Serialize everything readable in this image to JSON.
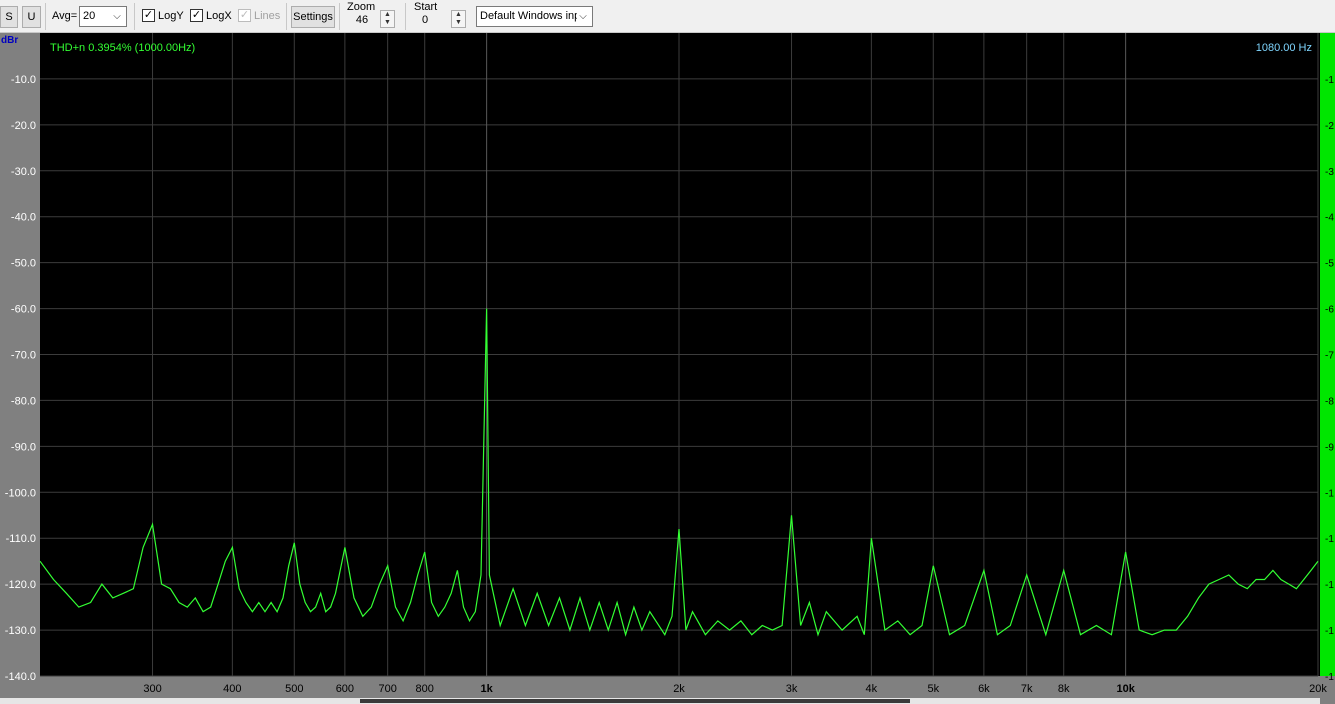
{
  "toolbar": {
    "s_label": "S",
    "u_label": "U",
    "avg_label": "Avg=",
    "avg_value": "20",
    "logy_label": "LogY",
    "logy_checked": true,
    "logx_label": "LogX",
    "logx_checked": true,
    "lines_label": "Lines",
    "lines_checked": true,
    "settings_label": "Settings",
    "zoom_label": "Zoom",
    "zoom_value": "46",
    "start_label": "Start",
    "start_value": "0",
    "input_device": "Default Windows inp",
    "check_mark": "✓",
    "chevron": "⌵",
    "spin_up": "▲",
    "spin_down": "▼"
  },
  "readouts": {
    "thd": "THD+n 0.3954% (1000.00Hz)",
    "cursor_freq": "1080.00 Hz",
    "y_unit": "dBr"
  },
  "colors": {
    "plot_bg": "#000000",
    "trace": "#33ff33",
    "grid": "#3c3c3c",
    "axis_bg": "#808080",
    "cursor_text": "#7fd6ff",
    "right_strip": "#00e600"
  },
  "chart_data": {
    "type": "line",
    "x_scale": "log",
    "xlim": [
      200,
      20000
    ],
    "ylim": [
      -140,
      0
    ],
    "grid": true,
    "y_ticks": [
      "-10.0",
      "-20.0",
      "-30.0",
      "-40.0",
      "-50.0",
      "-60.0",
      "-70.0",
      "-80.0",
      "-90.0",
      "-100.0",
      "-110.0",
      "-120.0",
      "-130.0",
      "-140.0"
    ],
    "y_tick_values": [
      -10,
      -20,
      -30,
      -40,
      -50,
      -60,
      -70,
      -80,
      -90,
      -100,
      -110,
      -120,
      -130,
      -140
    ],
    "right_ticks": [
      "-1",
      "-2",
      "-3",
      "-4",
      "-5",
      "-6",
      "-7",
      "-8",
      "-9",
      "-1",
      "-1",
      "-1",
      "-1",
      "-1"
    ],
    "x_ticks": [
      {
        "v": 300,
        "label": "300",
        "bold": false
      },
      {
        "v": 400,
        "label": "400",
        "bold": false
      },
      {
        "v": 500,
        "label": "500",
        "bold": false
      },
      {
        "v": 600,
        "label": "600",
        "bold": false
      },
      {
        "v": 700,
        "label": "700",
        "bold": false
      },
      {
        "v": 800,
        "label": "800",
        "bold": false
      },
      {
        "v": 1000,
        "label": "1k",
        "bold": true
      },
      {
        "v": 2000,
        "label": "2k",
        "bold": false
      },
      {
        "v": 3000,
        "label": "3k",
        "bold": false
      },
      {
        "v": 4000,
        "label": "4k",
        "bold": false
      },
      {
        "v": 5000,
        "label": "5k",
        "bold": false
      },
      {
        "v": 6000,
        "label": "6k",
        "bold": false
      },
      {
        "v": 7000,
        "label": "7k",
        "bold": false
      },
      {
        "v": 8000,
        "label": "8k",
        "bold": false
      },
      {
        "v": 10000,
        "label": "10k",
        "bold": true
      },
      {
        "v": 20000,
        "label": "20k",
        "bold": false
      }
    ],
    "series": [
      {
        "points": [
          [
            200,
            -115
          ],
          [
            210,
            -119
          ],
          [
            220,
            -122
          ],
          [
            230,
            -125
          ],
          [
            240,
            -124
          ],
          [
            250,
            -120
          ],
          [
            260,
            -123
          ],
          [
            270,
            -122
          ],
          [
            280,
            -121
          ],
          [
            290,
            -112
          ],
          [
            300,
            -107
          ],
          [
            310,
            -120
          ],
          [
            320,
            -121
          ],
          [
            330,
            -124
          ],
          [
            340,
            -125
          ],
          [
            350,
            -123
          ],
          [
            360,
            -126
          ],
          [
            370,
            -125
          ],
          [
            380,
            -120
          ],
          [
            390,
            -115
          ],
          [
            400,
            -112
          ],
          [
            410,
            -121
          ],
          [
            420,
            -124
          ],
          [
            430,
            -126
          ],
          [
            440,
            -124
          ],
          [
            450,
            -126
          ],
          [
            460,
            -124
          ],
          [
            470,
            -126
          ],
          [
            480,
            -123
          ],
          [
            490,
            -116
          ],
          [
            500,
            -111
          ],
          [
            510,
            -120
          ],
          [
            520,
            -124
          ],
          [
            530,
            -126
          ],
          [
            540,
            -125
          ],
          [
            550,
            -122
          ],
          [
            560,
            -126
          ],
          [
            570,
            -125
          ],
          [
            580,
            -122
          ],
          [
            590,
            -117
          ],
          [
            600,
            -112
          ],
          [
            620,
            -123
          ],
          [
            640,
            -127
          ],
          [
            660,
            -125
          ],
          [
            680,
            -120
          ],
          [
            700,
            -116
          ],
          [
            720,
            -125
          ],
          [
            740,
            -128
          ],
          [
            760,
            -124
          ],
          [
            780,
            -118
          ],
          [
            800,
            -113
          ],
          [
            820,
            -124
          ],
          [
            840,
            -127
          ],
          [
            860,
            -125
          ],
          [
            880,
            -122
          ],
          [
            900,
            -117
          ],
          [
            920,
            -125
          ],
          [
            940,
            -128
          ],
          [
            960,
            -126
          ],
          [
            980,
            -118
          ],
          [
            1000,
            -60
          ],
          [
            1010,
            -118
          ],
          [
            1050,
            -129
          ],
          [
            1100,
            -121
          ],
          [
            1150,
            -129
          ],
          [
            1200,
            -122
          ],
          [
            1250,
            -129
          ],
          [
            1300,
            -123
          ],
          [
            1350,
            -130
          ],
          [
            1400,
            -123
          ],
          [
            1450,
            -130
          ],
          [
            1500,
            -124
          ],
          [
            1550,
            -130
          ],
          [
            1600,
            -124
          ],
          [
            1650,
            -131
          ],
          [
            1700,
            -125
          ],
          [
            1750,
            -130
          ],
          [
            1800,
            -126
          ],
          [
            1900,
            -131
          ],
          [
            1950,
            -127
          ],
          [
            2000,
            -108
          ],
          [
            2050,
            -130
          ],
          [
            2100,
            -126
          ],
          [
            2200,
            -131
          ],
          [
            2300,
            -128
          ],
          [
            2400,
            -130
          ],
          [
            2500,
            -128
          ],
          [
            2600,
            -131
          ],
          [
            2700,
            -129
          ],
          [
            2800,
            -130
          ],
          [
            2900,
            -129
          ],
          [
            3000,
            -105
          ],
          [
            3100,
            -129
          ],
          [
            3200,
            -124
          ],
          [
            3300,
            -131
          ],
          [
            3400,
            -126
          ],
          [
            3600,
            -130
          ],
          [
            3800,
            -127
          ],
          [
            3900,
            -131
          ],
          [
            4000,
            -110
          ],
          [
            4200,
            -130
          ],
          [
            4400,
            -128
          ],
          [
            4600,
            -131
          ],
          [
            4800,
            -129
          ],
          [
            5000,
            -116
          ],
          [
            5300,
            -131
          ],
          [
            5600,
            -129
          ],
          [
            6000,
            -117
          ],
          [
            6300,
            -131
          ],
          [
            6600,
            -129
          ],
          [
            7000,
            -118
          ],
          [
            7500,
            -131
          ],
          [
            8000,
            -117
          ],
          [
            8500,
            -131
          ],
          [
            9000,
            -129
          ],
          [
            9500,
            -131
          ],
          [
            10000,
            -113
          ],
          [
            10500,
            -130
          ],
          [
            11000,
            -131
          ],
          [
            11500,
            -130
          ],
          [
            12000,
            -130
          ],
          [
            12500,
            -127
          ],
          [
            13000,
            -123
          ],
          [
            13500,
            -120
          ],
          [
            14000,
            -119
          ],
          [
            14500,
            -118
          ],
          [
            15000,
            -120
          ],
          [
            15500,
            -121
          ],
          [
            16000,
            -119
          ],
          [
            16500,
            -119
          ],
          [
            17000,
            -117
          ],
          [
            17500,
            -119
          ],
          [
            18000,
            -120
          ],
          [
            18500,
            -121
          ],
          [
            19000,
            -119
          ],
          [
            19500,
            -117
          ],
          [
            20000,
            -115
          ]
        ]
      }
    ]
  }
}
